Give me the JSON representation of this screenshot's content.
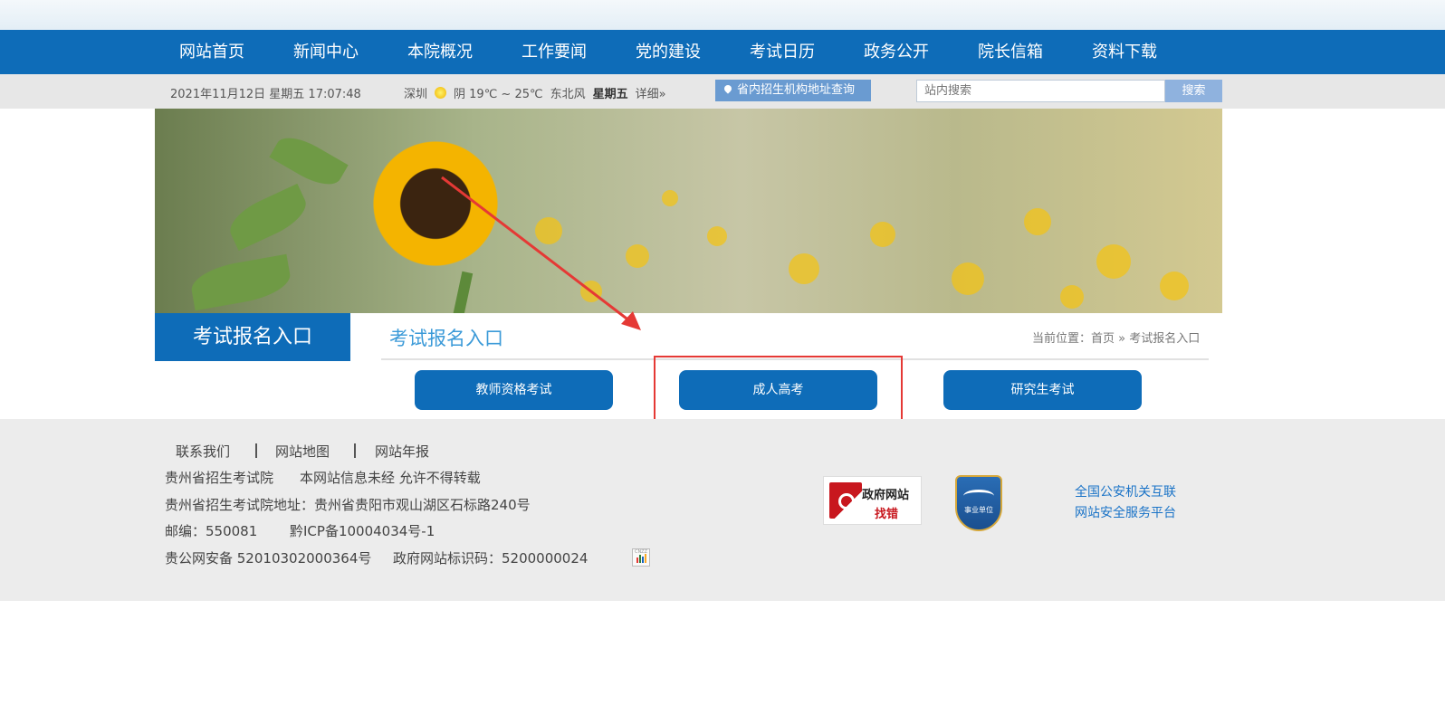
{
  "nav": {
    "items": [
      "网站首页",
      "新闻中心",
      "本院概况",
      "工作要闻",
      "党的建设",
      "考试日历",
      "政务公开",
      "院长信箱",
      "资料下载"
    ]
  },
  "infobar": {
    "datetime": "2021年11月12日  星期五  17:07:48",
    "city": "深圳",
    "weather": "阴 19℃ ~ 25℃",
    "wind": "东北风",
    "weekday": "星期五",
    "detail_link": "详细»",
    "address_query": "省内招生机构地址查询",
    "search_placeholder": "站内搜索",
    "search_button": "搜索"
  },
  "main": {
    "side_title": "考试报名入口",
    "section_title": "考试报名入口",
    "breadcrumb": "当前位置：首页 » 考试报名入口",
    "entries": [
      "教师资格考试",
      "成人高考",
      "研究生考试"
    ]
  },
  "footer": {
    "links": [
      "联系我们",
      "网站地图",
      "网站年报"
    ],
    "line1_org": "贵州省招生考试院",
    "line1_notice": "本网站信息未经 允许不得转载",
    "address": "贵州省招生考试院地址：贵州省贵阳市观山湖区石标路240号",
    "postcode": "邮编：550081",
    "icp": "黔ICP备10004034号-1",
    "police_record": "贵公网安备 52010302000364号",
    "gov_code": "政府网站标识码：5200000024",
    "cnzz_label": "CNZZ",
    "gov_badge_title": "政府网站",
    "gov_badge_sub": "找错",
    "shiye_label": "事业单位",
    "police_platform_line1": "全国公安机关互联",
    "police_platform_line2": "网站安全服务平台"
  },
  "colors": {
    "nav_blue": "#0e6cb8",
    "accent_light_blue": "#3b9ad8",
    "highlight_red": "#e53935"
  }
}
